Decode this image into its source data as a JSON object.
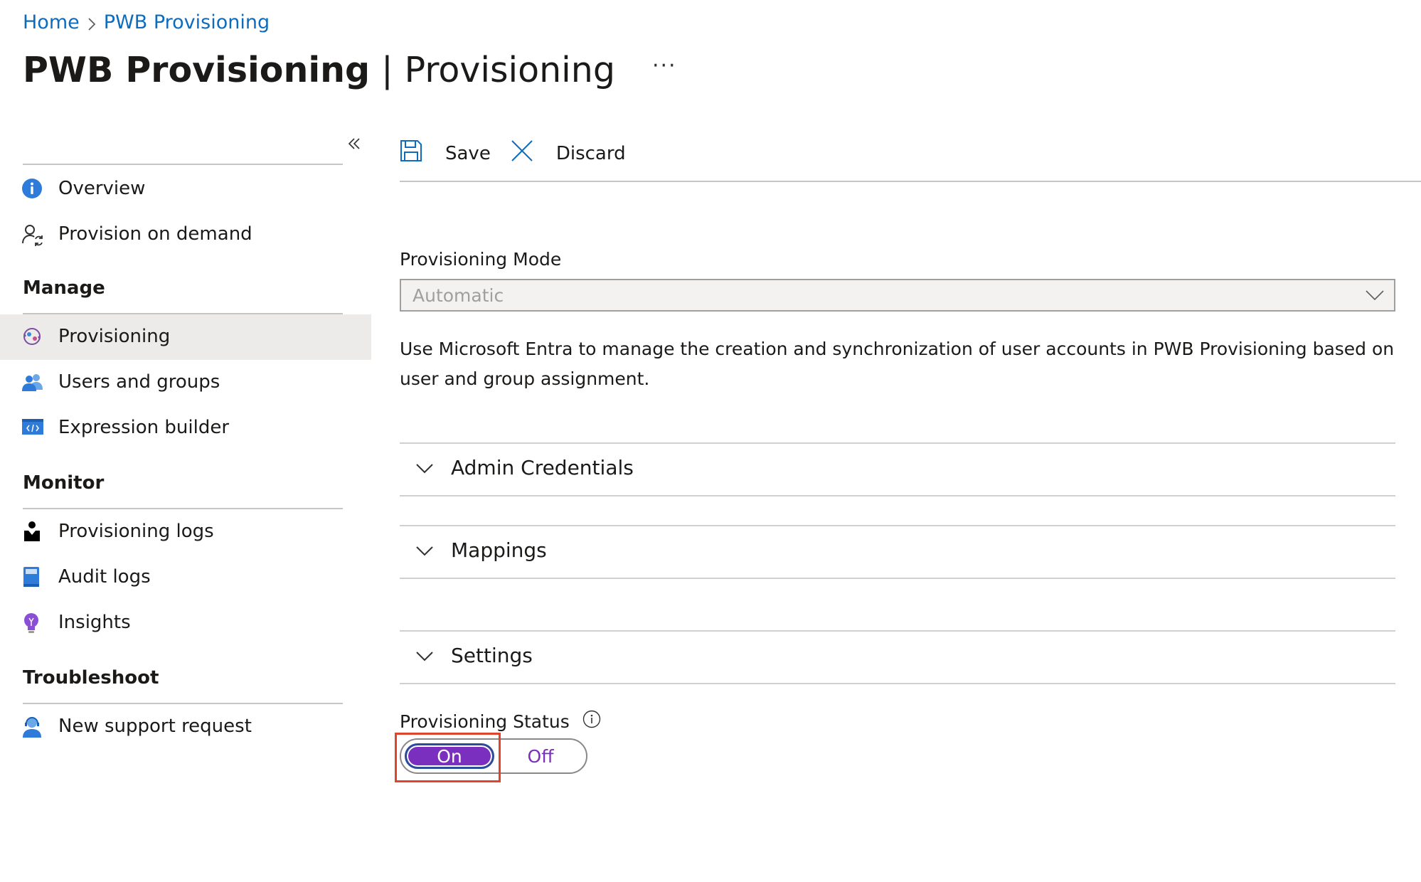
{
  "breadcrumb": {
    "home": "Home",
    "current": "PWB Provisioning"
  },
  "title": {
    "app": "PWB Provisioning",
    "separator": "|",
    "page": "Provisioning",
    "more": "···"
  },
  "sidebar": {
    "top_items": [
      {
        "label": "Overview",
        "icon": "info-icon"
      },
      {
        "label": "Provision on demand",
        "icon": "user-sync-icon"
      }
    ],
    "sections": [
      {
        "heading": "Manage",
        "items": [
          {
            "label": "Provisioning",
            "icon": "provisioning-icon",
            "active": true
          },
          {
            "label": "Users and groups",
            "icon": "users-groups-icon"
          },
          {
            "label": "Expression builder",
            "icon": "code-icon"
          }
        ]
      },
      {
        "heading": "Monitor",
        "items": [
          {
            "label": "Provisioning logs",
            "icon": "person-log-icon"
          },
          {
            "label": "Audit logs",
            "icon": "book-icon"
          },
          {
            "label": "Insights",
            "icon": "lightbulb-icon"
          }
        ]
      },
      {
        "heading": "Troubleshoot",
        "items": [
          {
            "label": "New support request",
            "icon": "support-agent-icon"
          }
        ]
      }
    ]
  },
  "toolbar": {
    "save_label": "Save",
    "discard_label": "Discard"
  },
  "provisioning_mode": {
    "label": "Provisioning Mode",
    "value": "Automatic",
    "description": "Use Microsoft Entra to manage the creation and synchronization of user accounts in PWB Provisioning based on user and group assignment."
  },
  "accordions": [
    {
      "label": "Admin Credentials"
    },
    {
      "label": "Mappings"
    },
    {
      "label": "Settings"
    }
  ],
  "provisioning_status": {
    "label": "Provisioning Status",
    "on_label": "On",
    "off_label": "Off",
    "selected": "On"
  },
  "colors": {
    "link": "#0f6cbd",
    "toggle_selected": "#7b2fbe",
    "highlight_box": "#e0452c"
  }
}
